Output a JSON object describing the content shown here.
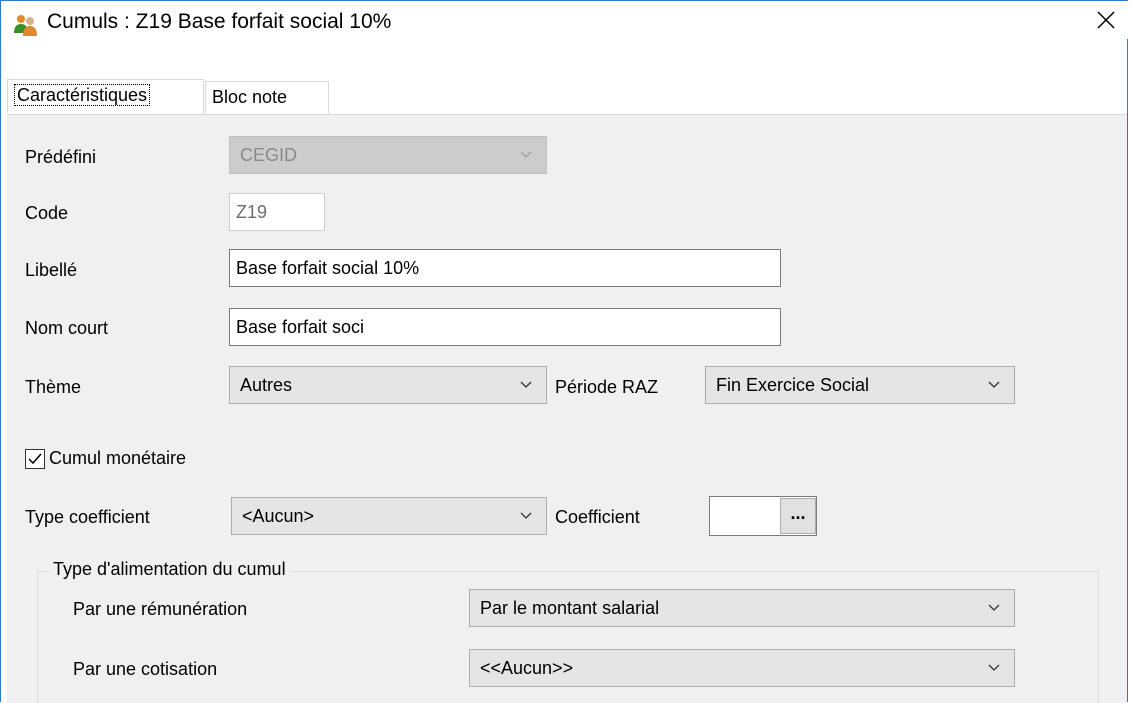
{
  "window": {
    "title": "Cumuls   : Z19 Base forfait social 10%",
    "close_icon": "close-icon",
    "app_icon": "users-icon"
  },
  "tabs": [
    {
      "label": "Caractéristiques",
      "active": true
    },
    {
      "label": "Bloc note",
      "active": false
    }
  ],
  "form": {
    "predefini": {
      "label": "Prédéfini",
      "value": "CEGID"
    },
    "code": {
      "label": "Code",
      "value": "Z19"
    },
    "libelle": {
      "label": "Libellé",
      "value": "Base forfait social 10%"
    },
    "nom_court": {
      "label": "Nom court",
      "value": "Base forfait soci"
    },
    "theme": {
      "label": "Thème",
      "value": "Autres"
    },
    "periode_raz": {
      "label": "Période RAZ",
      "value": "Fin Exercice Social"
    },
    "cumul_monetaire": {
      "label": "Cumul monétaire",
      "checked": true
    },
    "type_coefficient": {
      "label": "Type coefficient",
      "value": "<Aucun>"
    },
    "coefficient": {
      "label": "Coefficient",
      "value": "",
      "button": "..."
    }
  },
  "alimentation": {
    "title": "Type d'alimentation du cumul",
    "remuneration": {
      "label": "Par une rémunération",
      "value": "Par le montant salarial"
    },
    "cotisation": {
      "label": "Par une cotisation",
      "value": "<<Aucun>>"
    }
  }
}
